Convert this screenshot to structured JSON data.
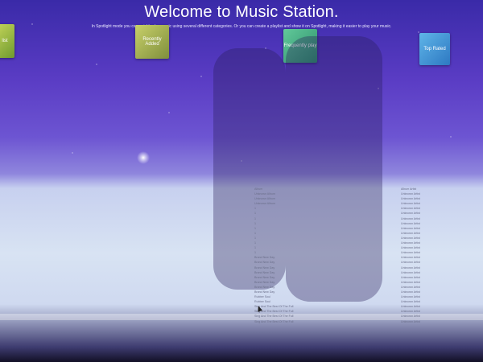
{
  "welcome": {
    "title": "Welcome to Music Station.",
    "subtitle": "In Spotlight mode you can quickly play music using several different categories. Or you can create a playlist and show it on Spotlight, making it easier to play your music."
  },
  "tiles": [
    {
      "label": "list"
    },
    {
      "label": "Recently Added"
    },
    {
      "label": "Frequently play"
    },
    {
      "label": "Top Rated"
    }
  ],
  "songs": {
    "album_column": [
      "Album",
      "Unknown Album",
      "Unknown Album",
      "Unknown Album",
      "1",
      "1",
      "1",
      "1",
      "1",
      "1",
      "1",
      "1",
      "1",
      "1",
      "Brand New Day",
      "Brand New Day",
      "Brand New Day",
      "Brand New Day",
      "Brand New Day",
      "Brand New Day",
      "Brand New Day",
      "Brand New Day",
      "Rubber Soul",
      "Rubber Soul",
      "Sing And The Best Of The Full",
      "Sing And The Best Of The Full",
      "Sing And The Best Of The Full",
      "Sing And The Best Of The Full"
    ],
    "artist_column": [
      "Album Artist",
      "Unknown Artist",
      "Unknown Artist",
      "Unknown Artist",
      "Unknown Artist",
      "Unknown Artist",
      "Unknown Artist",
      "Unknown Artist",
      "Unknown Artist",
      "Unknown Artist",
      "Unknown Artist",
      "Unknown Artist",
      "Unknown Artist",
      "Unknown Artist",
      "Unknown Artist",
      "Unknown Artist",
      "Unknown Artist",
      "Unknown Artist",
      "Unknown Artist",
      "Unknown Artist",
      "Unknown Artist",
      "Unknown Artist",
      "Unknown Artist",
      "Unknown Artist",
      "Unknown Artist",
      "Unknown Artist",
      "Unknown Artist",
      "Unknown Artist"
    ]
  }
}
